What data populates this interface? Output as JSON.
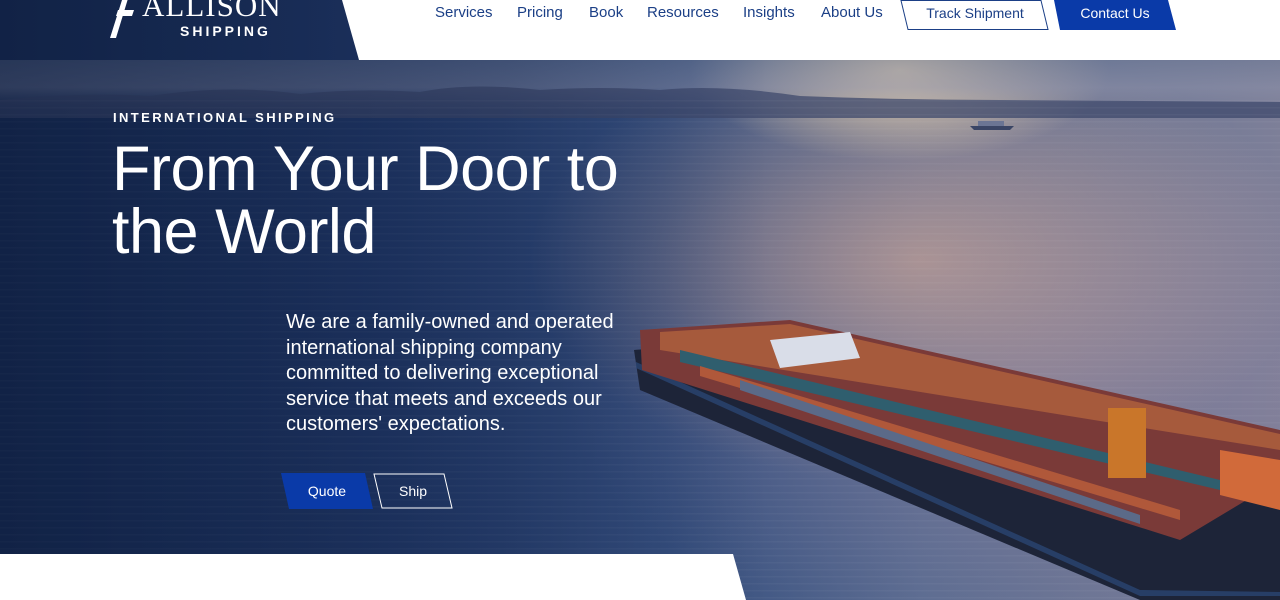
{
  "brand": {
    "name": "ALLISON",
    "sub": "SHIPPING"
  },
  "nav": {
    "links": [
      {
        "label": "Services"
      },
      {
        "label": "Pricing"
      },
      {
        "label": "Book"
      },
      {
        "label": "Resources"
      },
      {
        "label": "Insights"
      },
      {
        "label": "About Us"
      }
    ],
    "track_label": "Track Shipment",
    "contact_label": "Contact Us"
  },
  "hero": {
    "eyebrow": "INTERNATIONAL SHIPPING",
    "headline_line1": "From Your Door to",
    "headline_line2": "the World",
    "intro": "We are a family-owned and operated international shipping company committed to delivering exceptional service that meets and exceeds our customers' expectations.",
    "quote_label": "Quote",
    "ship_label": "Ship"
  },
  "colors": {
    "brand_blue": "#0a3aa8",
    "nav_text": "#1b3f86",
    "white": "#ffffff"
  }
}
